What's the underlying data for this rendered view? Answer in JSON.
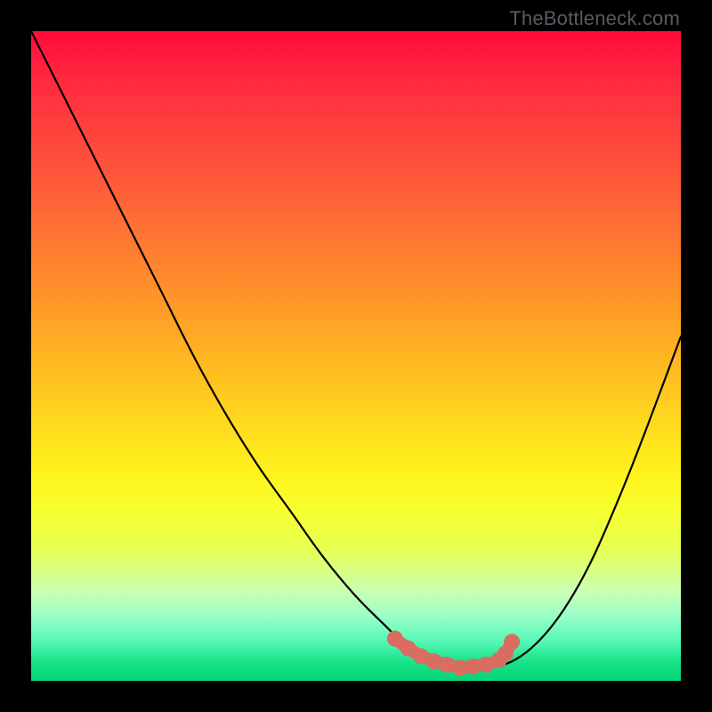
{
  "attribution": "TheBottleneck.com",
  "colors": {
    "curve_stroke": "#000000",
    "marker_fill": "#d96d62",
    "background_black": "#000000"
  },
  "chart_data": {
    "type": "line",
    "title": "",
    "xlabel": "",
    "ylabel": "",
    "xlim": [
      0,
      100
    ],
    "ylim": [
      0,
      100
    ],
    "series": [
      {
        "name": "bottleneck-curve",
        "x": [
          0,
          5,
          10,
          15,
          20,
          25,
          30,
          35,
          40,
          45,
          50,
          55,
          58,
          62,
          66,
          70,
          74,
          78,
          82,
          86,
          90,
          94,
          100
        ],
        "y": [
          100,
          90,
          80,
          70,
          60,
          50,
          41,
          33,
          26,
          19,
          13,
          8,
          5,
          3,
          2,
          2,
          3,
          6,
          11,
          18,
          27,
          37,
          53
        ]
      }
    ],
    "markers": {
      "name": "highlight-region",
      "x": [
        56,
        58,
        60,
        62,
        64,
        66,
        68,
        70,
        72,
        73,
        74
      ],
      "y": [
        6.5,
        5,
        3.8,
        3,
        2.5,
        2,
        2.2,
        2.5,
        3.2,
        4.2,
        6
      ]
    }
  }
}
